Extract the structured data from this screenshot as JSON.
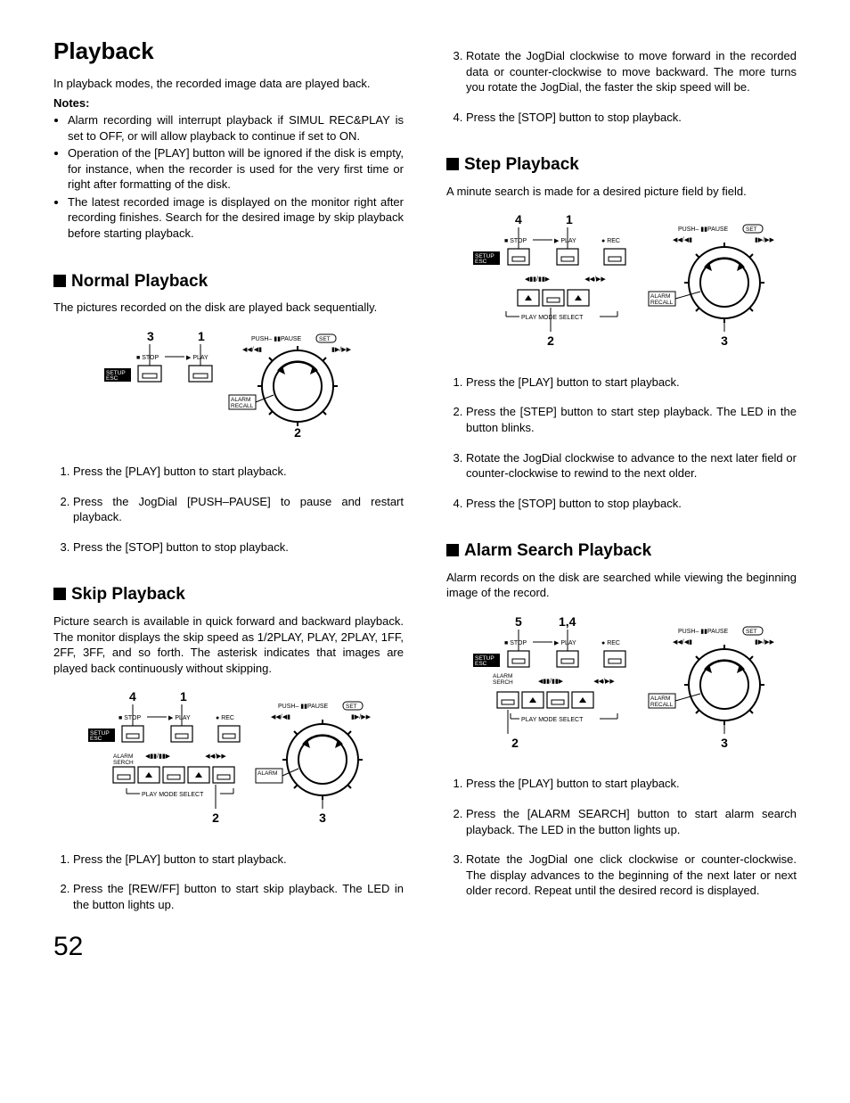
{
  "title": "Playback",
  "intro": "In playback modes, the recorded image data are played back.",
  "notes_label": "Notes:",
  "notes": [
    "Alarm recording will interrupt playback if SIMUL REC&PLAY is set to OFF, or will allow playback to continue if set to ON.",
    "Operation of the [PLAY] button will be ignored if the disk is empty, for instance, when the recorder is used for the very first time or right after formatting of the disk.",
    "The latest recorded image is displayed on the monitor right after recording finishes. Search for the desired image by skip playback before starting playback."
  ],
  "sections": {
    "normal": {
      "title": "Normal Playback",
      "text": "The pictures recorded on the disk are played back sequentially.",
      "steps": [
        "Press the [PLAY] button to start playback.",
        "Press the JogDial [PUSH–PAUSE] to pause and restart playback.",
        "Press the [STOP] button to stop playback."
      ]
    },
    "skip": {
      "title": "Skip Playback",
      "text": "Picture search is available in quick forward and backward playback. The monitor displays the skip speed as 1/2PLAY, PLAY, 2PLAY, 1FF, 2FF, 3FF, and so forth. The asterisk indicates that images are played back continuously without skipping.",
      "steps": [
        "Press the [PLAY] button to start playback.",
        "Press the [REW/FF] button to start skip playback. The LED in the button lights up.",
        "Rotate the JogDial clockwise to move forward in the recorded data or counter-clockwise to move backward. The more turns you rotate the JogDial, the faster the skip speed will be.",
        "Press the [STOP] button to stop playback."
      ]
    },
    "step": {
      "title": "Step Playback",
      "text": "A minute search is made for a desired picture field by field.",
      "steps": [
        "Press the [PLAY] button to start playback.",
        "Press the [STEP] button to start step playback. The LED in the button blinks.",
        "Rotate the JogDial clockwise to advance to the next later field or counter-clockwise to rewind to the next older.",
        "Press the [STOP] button to stop playback."
      ]
    },
    "alarm": {
      "title": "Alarm Search Playback",
      "text": "Alarm records on the disk are searched while viewing the beginning image of the record.",
      "steps": [
        "Press the [PLAY] button to start playback.",
        "Press the [ALARM SEARCH] button to start alarm search playback. The LED in the button lights up.",
        "Rotate the JogDial one click clockwise or counter-clockwise. The display advances to the beginning of the next later or next older record. Repeat until the desired record is displayed."
      ]
    }
  },
  "diagram_labels": {
    "push_pause": "PUSH",
    "pause": "PAUSE",
    "set": "SET",
    "stop": "STOP",
    "play": "PLAY",
    "rec": "REC",
    "setup_esc_1": "SETUP",
    "setup_esc_2": "ESC",
    "alarm_recall_1": "ALARM",
    "alarm_recall_2": "RECALL",
    "alarm_serch_1": "ALARM",
    "alarm_serch_2": "SERCH",
    "play_mode_select": "PLAY MODE SELECT"
  },
  "page_number": "52"
}
